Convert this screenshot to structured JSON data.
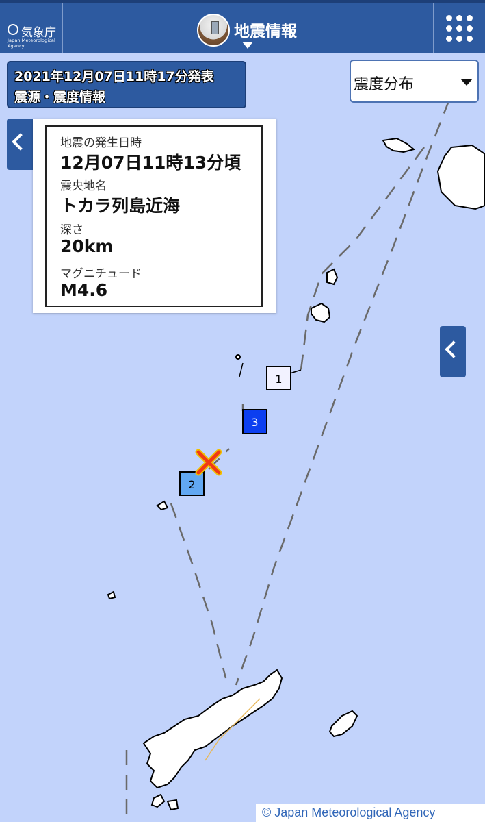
{
  "header": {
    "logo_text": "気象庁",
    "logo_sub": "Japan Meteorological Agency",
    "title": "地震情報"
  },
  "announcement": {
    "datetime": "2021年12月07日11時17分発表",
    "type": "震源・震度情報"
  },
  "dropdown": {
    "selected": "震度分布"
  },
  "info": {
    "occurrence_label": "地震の発生日時",
    "occurrence_value": "12月07日11時13分頃",
    "epicenter_label": "震央地名",
    "epicenter_value": "トカラ列島近海",
    "depth_label": "深さ",
    "depth_value": "20km",
    "magnitude_label": "マグニチュード",
    "magnitude_value": "M4.6"
  },
  "intensity_markers": [
    {
      "level": "1",
      "color": "#f2f2ff"
    },
    {
      "level": "3",
      "color": "#0c3ff0"
    },
    {
      "level": "2",
      "color": "#62a8f2"
    }
  ],
  "epicenter_marker": {
    "color": "#f03a14"
  },
  "colors": {
    "header": "#2d5aa0",
    "sea": "#c2d3fb",
    "accent_text": "#3066b8"
  },
  "copyright": "© Japan Meteorological Agency"
}
